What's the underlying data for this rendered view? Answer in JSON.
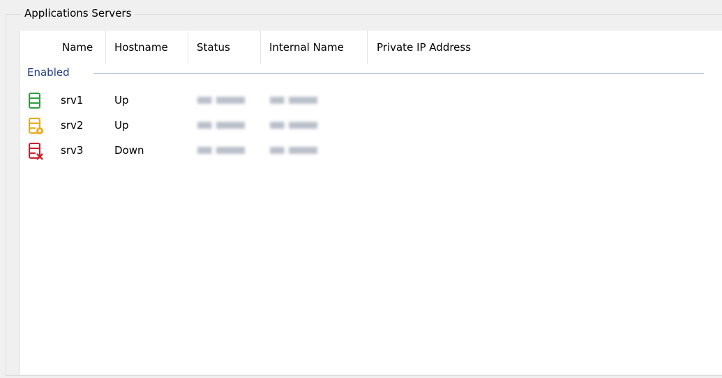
{
  "groupbox": {
    "title": "Applications Servers"
  },
  "columns": [
    "Name",
    "Hostname",
    "Status",
    "Internal Name",
    "Private IP Address"
  ],
  "group": {
    "label": "Enabled"
  },
  "rows": [
    {
      "icon": "server-up-icon",
      "name": "srv1",
      "status": "Up"
    },
    {
      "icon": "server-warning-icon",
      "name": "srv2",
      "status": "Up"
    },
    {
      "icon": "server-down-icon",
      "name": "srv3",
      "status": "Down"
    }
  ],
  "colors": {
    "up_green": "#2e9e3e",
    "warning_orange": "#f0a81d",
    "down_red": "#cc1e2c",
    "group_label_blue": "#1e3a8a"
  }
}
